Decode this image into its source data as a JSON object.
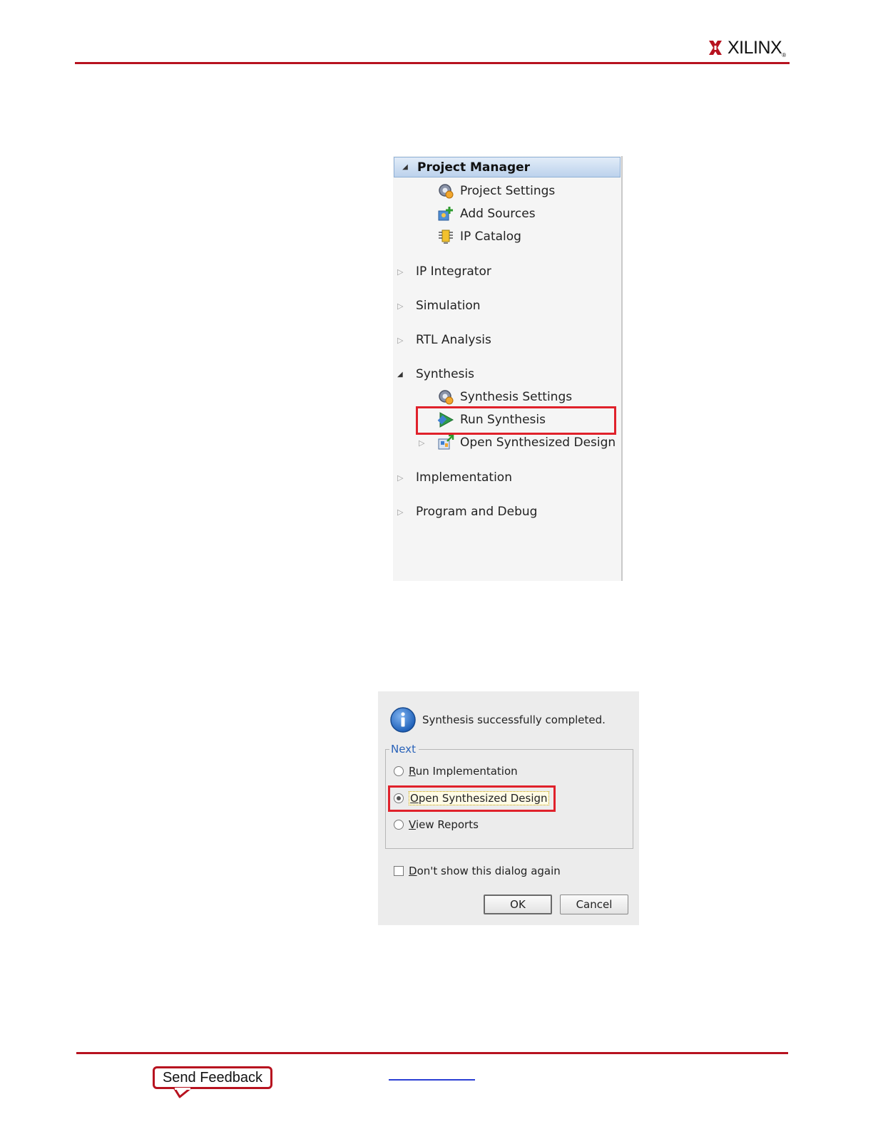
{
  "header": {
    "brand": "XILINX",
    "brand_mark": "®",
    "logo_color": "#b7121f",
    "rule_color": "#b7121f"
  },
  "flow_navigator": {
    "sections": [
      {
        "label": "Project Manager",
        "expanded": true
      },
      {
        "label": "IP Integrator",
        "expanded": false
      },
      {
        "label": "Simulation",
        "expanded": false
      },
      {
        "label": "RTL Analysis",
        "expanded": false
      },
      {
        "label": "Synthesis",
        "expanded": true
      },
      {
        "label": "Implementation",
        "expanded": false
      },
      {
        "label": "Program and Debug",
        "expanded": false
      }
    ],
    "project_manager_items": [
      {
        "label": "Project Settings",
        "icon": "gear-icon"
      },
      {
        "label": "Add Sources",
        "icon": "add-sources-icon"
      },
      {
        "label": "IP Catalog",
        "icon": "ip-chip-icon"
      }
    ],
    "synthesis_items": [
      {
        "label": "Synthesis Settings",
        "icon": "gear-icon"
      },
      {
        "label": "Run Synthesis",
        "icon": "run-arrow-icon",
        "highlighted": true
      },
      {
        "label": "Open Synthesized Design",
        "icon": "open-design-icon"
      }
    ],
    "highlight_color": "#e0212b"
  },
  "dialog": {
    "message": "Synthesis successfully completed.",
    "group_label": "Next",
    "options": [
      {
        "mnemonic": "R",
        "rest": "un Implementation",
        "selected": false
      },
      {
        "mnemonic": "O",
        "rest": "pen Synthesized Design",
        "selected": true
      },
      {
        "mnemonic": "V",
        "rest": "iew Reports",
        "selected": false
      }
    ],
    "checkbox": {
      "mnemonic": "D",
      "rest": "on't show this dialog again",
      "checked": false
    },
    "ok_label": "OK",
    "cancel_label": "Cancel"
  },
  "footer": {
    "send_feedback": "Send Feedback"
  }
}
